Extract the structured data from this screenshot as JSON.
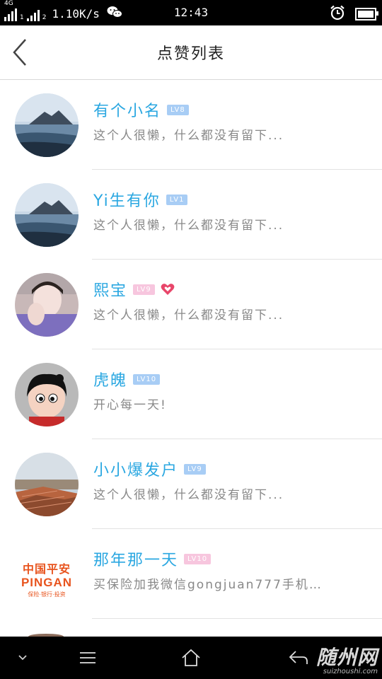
{
  "status_bar": {
    "network": "4G",
    "sim_slot_1": "1",
    "sim_slot_2": "2",
    "net_speed": "1.10K/s",
    "time": "12:43",
    "icons": [
      "signal-icon",
      "wechat-icon",
      "alarm-icon",
      "battery-icon"
    ]
  },
  "header": {
    "title": "点赞列表",
    "back_icon": "chevron-left-icon"
  },
  "likes": [
    {
      "name": "有个小名",
      "level": "LV8",
      "level_color": "#a8cdf5",
      "signature": "这个人很懒，什么都没有留下...",
      "avatar": "lake-landscape"
    },
    {
      "name": "Yi生有你",
      "level": "LV1",
      "level_color": "#a8cdf5",
      "signature": "这个人很懒，什么都没有留下...",
      "avatar": "lake-landscape"
    },
    {
      "name": "熙宝",
      "level": "LV9",
      "level_color": "#f7c6de",
      "signature": "这个人很懒，什么都没有留下...",
      "avatar": "selfie",
      "badge": "heart-icon"
    },
    {
      "name": "虎魄",
      "level": "LV10",
      "level_color": "#a8cdf5",
      "signature": "开心每一天!",
      "avatar": "cartoon-boy"
    },
    {
      "name": "小小爆发户",
      "level": "LV9",
      "level_color": "#a8cdf5",
      "signature": "这个人很懒，什么都没有留下...",
      "avatar": "rooftops"
    },
    {
      "name": "那年那一天",
      "level": "LV10",
      "level_color": "#f7c6de",
      "signature": "买保险加我微信gongjuan777手机…",
      "avatar": "pingan-logo",
      "logo_text": {
        "cn": "中国平安",
        "en": "PINGAN",
        "sub": "保险·银行·投资"
      }
    }
  ],
  "nav_bar": {
    "icons": [
      "chevron-down-icon",
      "menu-icon",
      "home-icon",
      "back-icon"
    ]
  },
  "watermark": {
    "main": "随州网",
    "sub": "suizhoushi.com"
  },
  "colors": {
    "name": "#2aa7e1",
    "signature": "#888888",
    "divider": "#e2e2e2"
  }
}
